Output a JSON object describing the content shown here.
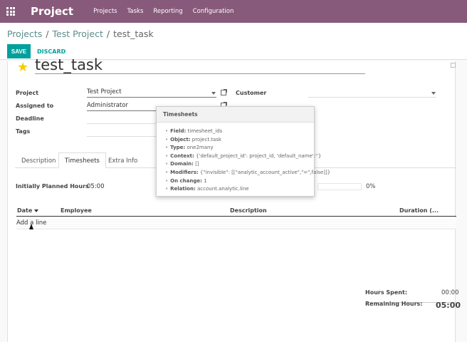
{
  "topbar": {
    "brand": "Project",
    "menu": [
      "Projects",
      "Tasks",
      "Reporting",
      "Configuration"
    ]
  },
  "breadcrumb": {
    "parent1": "Projects",
    "parent2": "Test Project",
    "current": "test_task",
    "separator": "/"
  },
  "actions": {
    "save": "SAVE",
    "discard": "DISCARD"
  },
  "task": {
    "title": "test_task",
    "fields": {
      "project_label": "Project",
      "project_value": "Test Project",
      "assigned_label": "Assigned to",
      "assigned_value": "Administrator",
      "deadline_label": "Deadline",
      "tags_label": "Tags",
      "customer_label": "Customer"
    }
  },
  "tabs": [
    "Description",
    "Timesheets",
    "Extra Info"
  ],
  "timesheets": {
    "planned_label": "Initially Planned Hours",
    "planned_value": "05:00",
    "progress_percent": "0%",
    "columns": [
      "Date",
      "Employee",
      "Description",
      "Duration (..."
    ],
    "add_line": "Add a line",
    "hours_spent_label": "Hours Spent:",
    "hours_spent_value": "00:00",
    "remaining_label": "Remaining Hours:",
    "remaining_value": "05:00"
  },
  "tooltip": {
    "title": "Timesheets",
    "items": [
      {
        "k": "Field:",
        "v": "timesheet_ids"
      },
      {
        "k": "Object:",
        "v": "project.task"
      },
      {
        "k": "Type:",
        "v": "one2many"
      },
      {
        "k": "Context:",
        "v": "{'default_project_id': project_id, 'default_name':''}"
      },
      {
        "k": "Domain:",
        "v": "[]"
      },
      {
        "k": "Modifiers:",
        "v": "{\"invisible\": [[\"analytic_account_active\",\"=\",false]]}"
      },
      {
        "k": "On change:",
        "v": "1"
      },
      {
        "k": "Relation:",
        "v": "account.analytic.line"
      }
    ]
  },
  "colors": {
    "topbar": "#875a7b",
    "accent": "#00a09d",
    "star": "#f3cc00"
  }
}
